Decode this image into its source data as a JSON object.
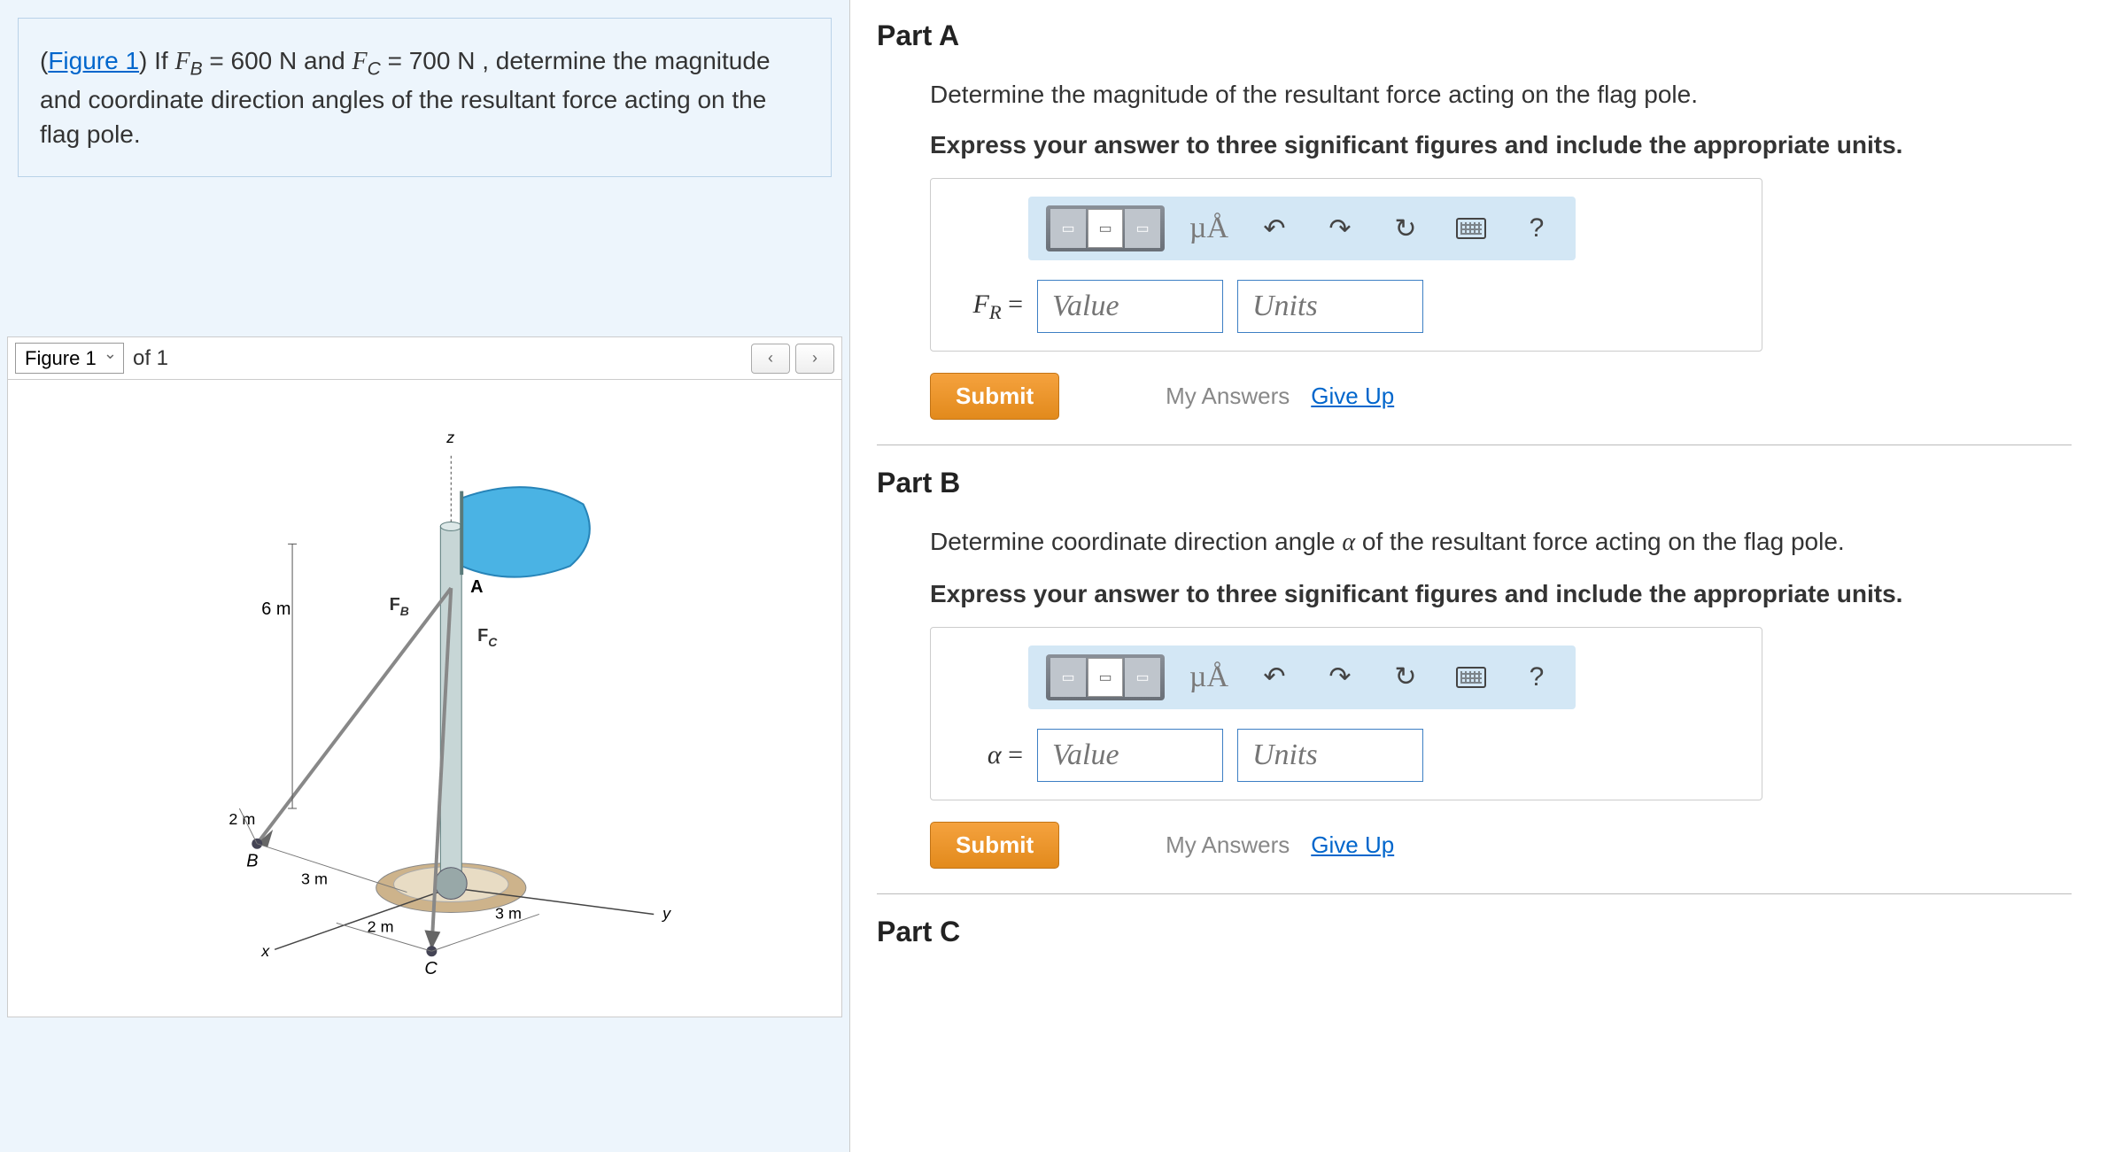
{
  "problem": {
    "figure_link": "Figure 1",
    "text_pre_link": "(",
    "text_after_link": ") If ",
    "fb_var": "F",
    "fb_sub": "B",
    "fb_eq": " = 600 N and ",
    "fc_var": "F",
    "fc_sub": "C",
    "fc_eq": " = 700 N , determine the magnitude and coordinate direction angles of the resultant force acting on the flag pole."
  },
  "figure": {
    "select_value": "Figure 1",
    "of_label": "of 1",
    "labels": {
      "z": "z",
      "y": "y",
      "x": "x",
      "A": "A",
      "B": "B",
      "C": "C",
      "FB": "F",
      "FB_sub": "B",
      "FC": "F",
      "FC_sub": "C",
      "d6m": "6 m",
      "d2m_a": "2 m",
      "d3m_a": "3 m",
      "d2m_b": "2 m",
      "d3m_b": "3 m"
    }
  },
  "parts": [
    {
      "title": "Part A",
      "prompt": "Determine the magnitude of the resultant force acting on the flag pole.",
      "instruction": "Express your answer to three significant figures and include the appropriate units.",
      "var_html": "F<span class='sub' style='font-style:italic'>R</span> <span class='eq'>=</span>",
      "value_placeholder": "Value",
      "units_placeholder": "Units",
      "submit": "Submit",
      "my_answers": "My Answers",
      "give_up": "Give Up"
    },
    {
      "title": "Part B",
      "prompt_pre": "Determine coordinate direction angle ",
      "prompt_var": "α",
      "prompt_post": " of the resultant force acting on the flag pole.",
      "instruction": "Express your answer to three significant figures and include the appropriate units.",
      "var_html": "α <span class='eq'>=</span>",
      "value_placeholder": "Value",
      "units_placeholder": "Units",
      "submit": "Submit",
      "my_answers": "My Answers",
      "give_up": "Give Up"
    },
    {
      "title": "Part C"
    }
  ],
  "toolbar": {
    "muA": "µÅ",
    "help": "?"
  }
}
